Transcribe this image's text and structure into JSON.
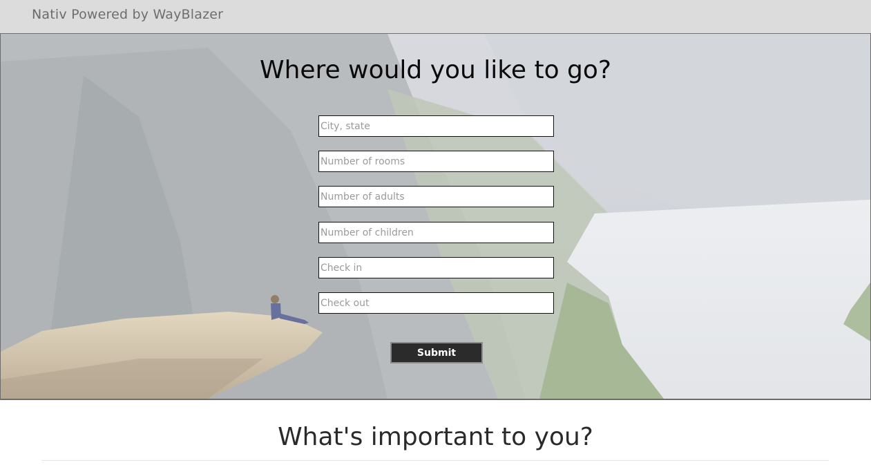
{
  "header": {
    "brand_name": "Nativ",
    "brand_tagline": "Powered by WayBlazer"
  },
  "hero": {
    "title": "Where would you like to go?",
    "fields": [
      {
        "placeholder": "City, state",
        "value": ""
      },
      {
        "placeholder": "Number of rooms",
        "value": ""
      },
      {
        "placeholder": "Number of adults",
        "value": ""
      },
      {
        "placeholder": "Number of children",
        "value": ""
      },
      {
        "placeholder": "Check in",
        "value": ""
      },
      {
        "placeholder": "Check out",
        "value": ""
      }
    ],
    "submit_label": "Submit"
  },
  "preferences": {
    "title": "What's important to you?"
  },
  "colors": {
    "topbar_bg": "#dcdcdc",
    "button_bg": "#2b2b2b",
    "button_text": "#ffffff"
  }
}
